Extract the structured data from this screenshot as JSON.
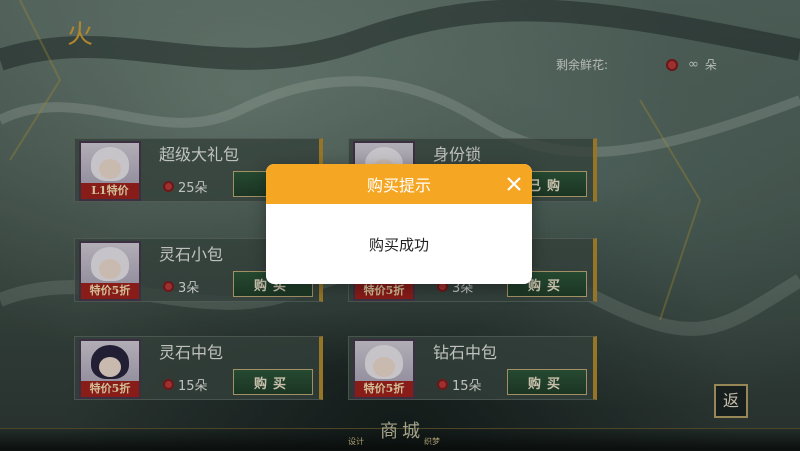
{
  "header": {
    "badge_glyph": "火",
    "remaining_label": "剩余鲜花:",
    "remaining_value": "∞",
    "remaining_unit": "朵"
  },
  "items": [
    {
      "name": "超级大礼包",
      "tag": "L1特价",
      "price": "25朵",
      "buy_label": "",
      "hair": "light"
    },
    {
      "name": "身份锁",
      "tag": "",
      "price": "",
      "buy_label": "已购",
      "hair": "light"
    },
    {
      "name": "灵石小包",
      "tag": "特价5折",
      "price": "3朵",
      "buy_label": "购买",
      "hair": "light"
    },
    {
      "name": "",
      "tag": "特价5折",
      "price": "3朵",
      "buy_label": "购买",
      "hair": "light"
    },
    {
      "name": "灵石中包",
      "tag": "特价5折",
      "price": "15朵",
      "buy_label": "购买",
      "hair": "dark"
    },
    {
      "name": "钻石中包",
      "tag": "特价5折",
      "price": "15朵",
      "buy_label": "购买",
      "hair": "light"
    }
  ],
  "footer": {
    "title": "商城",
    "left_label": "设计",
    "right_label": "织梦",
    "back_label": "返"
  },
  "dialog": {
    "title": "购买提示",
    "message": "购买成功",
    "close_icon": "close-icon"
  },
  "colors": {
    "dialog_header": "#f5a623",
    "buy_button": "#2f5a3c",
    "tag": "#a5231f",
    "flower": "#c23b3b"
  }
}
